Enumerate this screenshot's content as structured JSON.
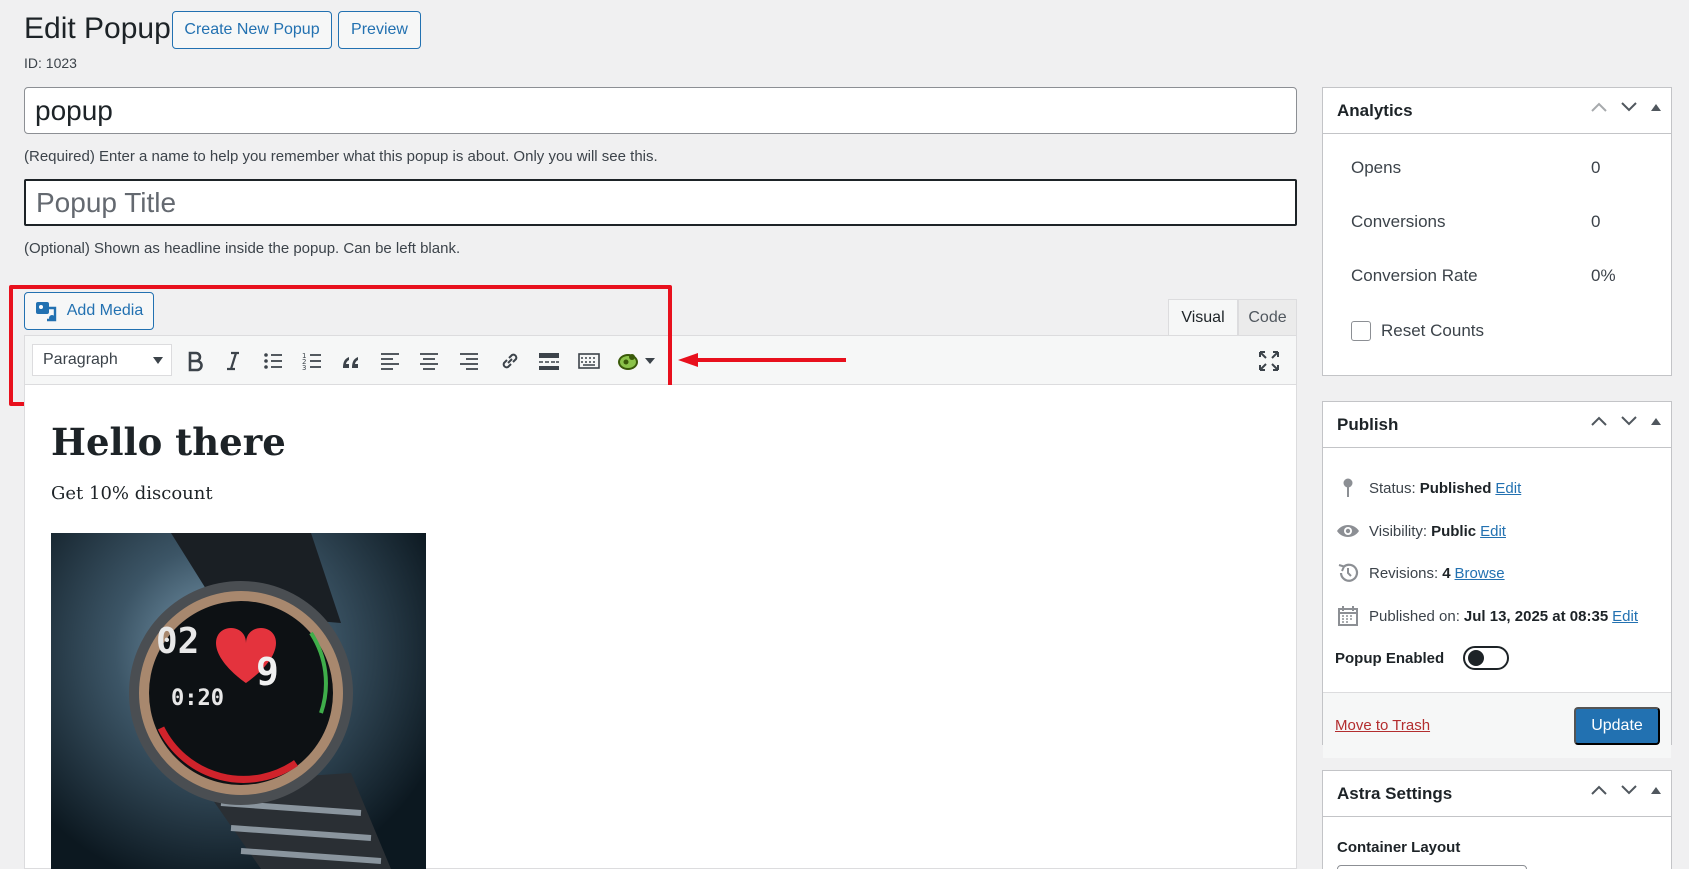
{
  "header": {
    "title": "Edit Popup",
    "create_new_label": "Create New Popup",
    "preview_label": "Preview",
    "post_id": "ID: 1023"
  },
  "form": {
    "name_value": "popup",
    "name_hint": "(Required) Enter a name to help you remember what this popup is about. Only you will see this.",
    "title_placeholder": "Popup Title",
    "title_hint": "(Optional) Shown as headline inside the popup. Can be left blank."
  },
  "editor": {
    "add_media_label": "Add Media",
    "tabs": {
      "visual": "Visual",
      "code": "Code"
    },
    "format_select": "Paragraph",
    "toolbar_icons": [
      "bold-icon",
      "italic-icon",
      "bulleted-list-icon",
      "numbered-list-icon",
      "blockquote-icon",
      "align-left-icon",
      "align-center-icon",
      "align-right-icon",
      "link-icon",
      "read-more-icon",
      "toolbar-toggle-icon",
      "plugin-shortcode-icon",
      "fullscreen-icon"
    ],
    "content": {
      "heading": "Hello there",
      "paragraph": "Get 10% discount"
    },
    "annotation_color": "#e8101d"
  },
  "analytics": {
    "title": "Analytics",
    "rows": [
      {
        "label": "Opens",
        "value": "0"
      },
      {
        "label": "Conversions",
        "value": "0"
      },
      {
        "label": "Conversion Rate",
        "value": "0%"
      }
    ],
    "reset_label": "Reset Counts"
  },
  "publish": {
    "title": "Publish",
    "status_label": "Status:",
    "status_value": "Published",
    "visibility_label": "Visibility:",
    "visibility_value": "Public",
    "revisions_label": "Revisions:",
    "revisions_value": "4",
    "browse_label": "Browse",
    "published_label": "Published on:",
    "published_value": "Jul 13, 2025 at 08:35",
    "edit_label": "Edit",
    "popup_enabled_label": "Popup Enabled",
    "trash_label": "Move to Trash",
    "update_label": "Update"
  },
  "astra": {
    "title": "Astra Settings",
    "container_layout_label": "Container Layout"
  },
  "colors": {
    "primary": "#2271b1",
    "danger": "#b32d2e"
  }
}
